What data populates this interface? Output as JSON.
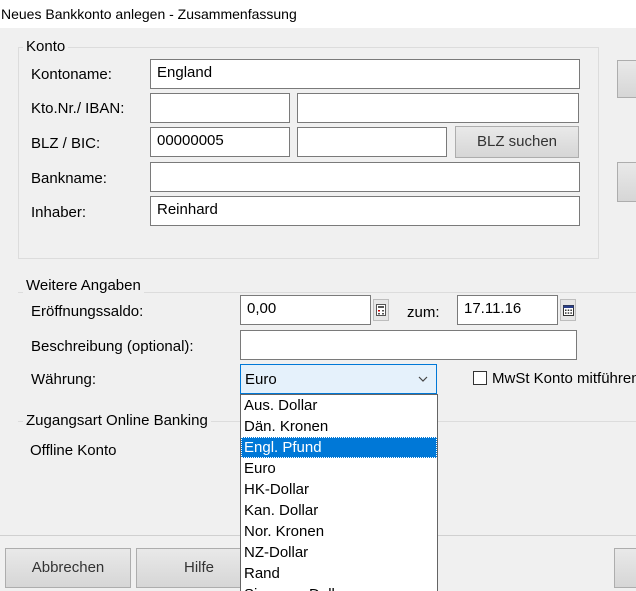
{
  "window": {
    "title": "Neues Bankkonto anlegen - Zusammenfassung"
  },
  "konto": {
    "legend": "Konto",
    "kontoname_label": "Kontoname:",
    "kontoname_value": "England",
    "ktonr_label": "Kto.Nr./ IBAN:",
    "ktonr_value": "",
    "iban_value": "",
    "blz_label": "BLZ / BIC:",
    "blz_value": "00000005",
    "bic_value": "",
    "blz_suchen_label": "BLZ suchen",
    "bankname_label": "Bankname:",
    "bankname_value": "",
    "inhaber_label": "Inhaber:",
    "inhaber_value": "Reinhard"
  },
  "weitere": {
    "legend": "Weitere Angaben",
    "eroeffnung_label": "Eröffnungssaldo:",
    "eroeffnung_value": "0,00",
    "zum_label": "zum:",
    "zum_value": "17.11.16",
    "beschreibung_label": "Beschreibung (optional):",
    "beschreibung_value": "",
    "waehrung_label": "Währung:",
    "waehrung_value": "Euro",
    "waehrung_options": [
      "Aus. Dollar",
      "Dän. Kronen",
      "Engl. Pfund",
      "Euro",
      "HK-Dollar",
      "Kan. Dollar",
      "Nor. Kronen",
      "NZ-Dollar",
      "Rand",
      "Singapur-Dollar"
    ],
    "highlighted_option": "Engl. Pfund",
    "mwst_label": "MwSt Konto mitführen",
    "mwst_checked": false
  },
  "zugang": {
    "legend": "Zugangsart Online Banking",
    "value": "Offline Konto"
  },
  "footer": {
    "abbrechen_label": "Abbrechen",
    "hilfe_label": "Hilfe"
  },
  "icons": {
    "calendar": "calendar-icon",
    "chevron": "chevron-down-icon",
    "calculator": "calculator-icon"
  },
  "colors": {
    "selection": "#0078d7",
    "button": "#dcdcdc"
  }
}
